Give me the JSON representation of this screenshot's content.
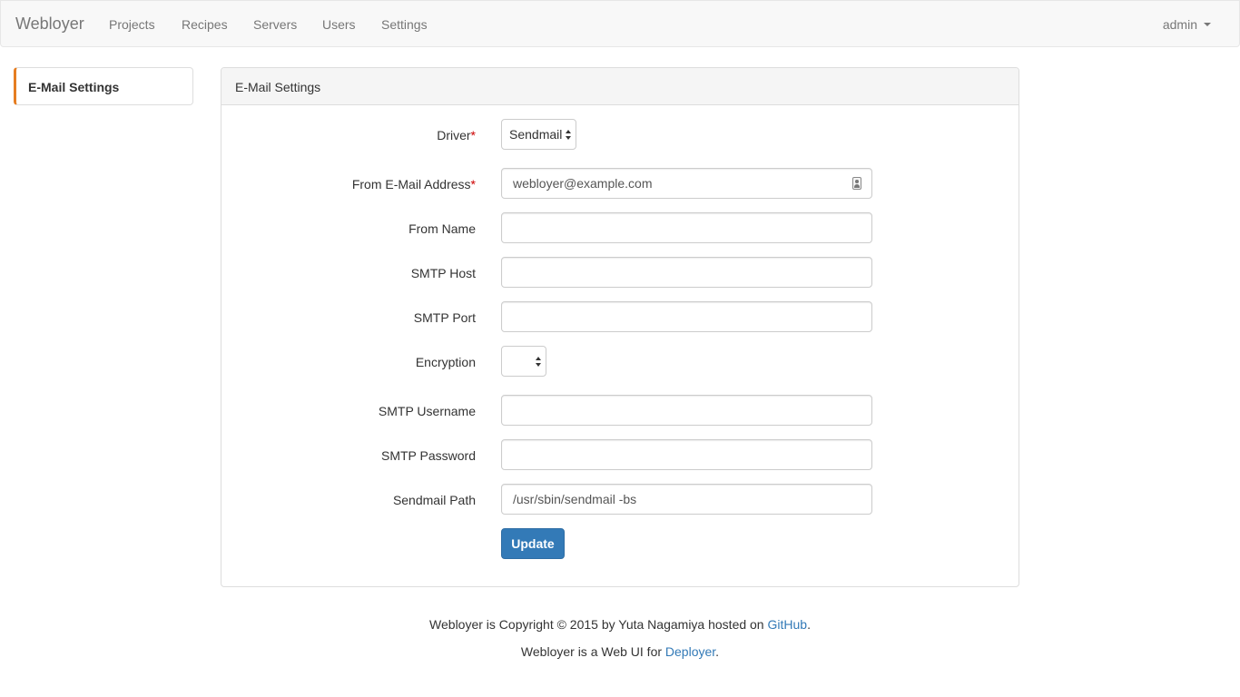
{
  "navbar": {
    "brand": "Webloyer",
    "links": [
      "Projects",
      "Recipes",
      "Servers",
      "Users",
      "Settings"
    ],
    "user_menu": "admin"
  },
  "sidebar": {
    "items": [
      {
        "label": "E-Mail Settings",
        "active": true
      }
    ]
  },
  "panel": {
    "title": "E-Mail Settings"
  },
  "form": {
    "driver": {
      "label": "Driver",
      "required": "*",
      "value": "Sendmail"
    },
    "from_address": {
      "label": "From E-Mail Address",
      "required": "*",
      "value": "webloyer@example.com"
    },
    "from_name": {
      "label": "From Name",
      "value": ""
    },
    "smtp_host": {
      "label": "SMTP Host",
      "value": ""
    },
    "smtp_port": {
      "label": "SMTP Port",
      "value": ""
    },
    "encryption": {
      "label": "Encryption",
      "value": ""
    },
    "smtp_username": {
      "label": "SMTP Username",
      "value": ""
    },
    "smtp_password": {
      "label": "SMTP Password",
      "value": ""
    },
    "sendmail_path": {
      "label": "Sendmail Path",
      "value": "/usr/sbin/sendmail -bs"
    },
    "submit_label": "Update"
  },
  "footer": {
    "line1_prefix": "Webloyer is Copyright © 2015 by Yuta Nagamiya hosted on ",
    "line1_link": "GitHub",
    "line1_suffix": ".",
    "line2_prefix": "Webloyer is a Web UI for ",
    "line2_link": "Deployer",
    "line2_suffix": "."
  },
  "colors": {
    "accent": "#e67e22",
    "primary": "#337ab7",
    "required": "#cc0000"
  }
}
